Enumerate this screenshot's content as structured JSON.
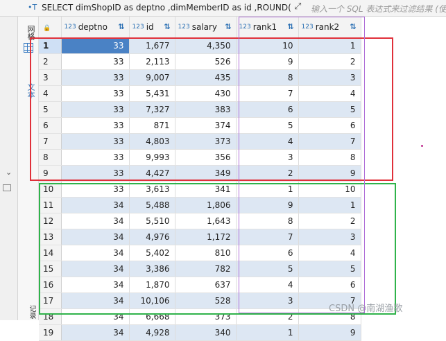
{
  "query": {
    "sql": "SELECT dimShopID as deptno ,dimMemberID as id ,ROUND(",
    "filter_placeholder": "输入一个 SQL 表达式来过滤结果 (使"
  },
  "sidebar": {
    "grid_tab": "网格",
    "text_tab": "文本",
    "record_tab": "记录"
  },
  "table": {
    "type_tag": "123",
    "columns": [
      "deptno",
      "id",
      "salary",
      "rank1",
      "rank2"
    ],
    "rows": [
      {
        "n": "1",
        "deptno": "33",
        "id": "1,677",
        "salary": "4,350",
        "rank1": "10",
        "rank2": "1"
      },
      {
        "n": "2",
        "deptno": "33",
        "id": "2,113",
        "salary": "526",
        "rank1": "9",
        "rank2": "2"
      },
      {
        "n": "3",
        "deptno": "33",
        "id": "9,007",
        "salary": "435",
        "rank1": "8",
        "rank2": "3"
      },
      {
        "n": "4",
        "deptno": "33",
        "id": "5,431",
        "salary": "430",
        "rank1": "7",
        "rank2": "4"
      },
      {
        "n": "5",
        "deptno": "33",
        "id": "7,327",
        "salary": "383",
        "rank1": "6",
        "rank2": "5"
      },
      {
        "n": "6",
        "deptno": "33",
        "id": "871",
        "salary": "374",
        "rank1": "5",
        "rank2": "6"
      },
      {
        "n": "7",
        "deptno": "33",
        "id": "4,803",
        "salary": "373",
        "rank1": "4",
        "rank2": "7"
      },
      {
        "n": "8",
        "deptno": "33",
        "id": "9,993",
        "salary": "356",
        "rank1": "3",
        "rank2": "8"
      },
      {
        "n": "9",
        "deptno": "33",
        "id": "4,427",
        "salary": "349",
        "rank1": "2",
        "rank2": "9"
      },
      {
        "n": "10",
        "deptno": "33",
        "id": "3,613",
        "salary": "341",
        "rank1": "1",
        "rank2": "10"
      },
      {
        "n": "11",
        "deptno": "34",
        "id": "5,488",
        "salary": "1,806",
        "rank1": "9",
        "rank2": "1"
      },
      {
        "n": "12",
        "deptno": "34",
        "id": "5,510",
        "salary": "1,643",
        "rank1": "8",
        "rank2": "2"
      },
      {
        "n": "13",
        "deptno": "34",
        "id": "4,976",
        "salary": "1,172",
        "rank1": "7",
        "rank2": "3"
      },
      {
        "n": "14",
        "deptno": "34",
        "id": "5,402",
        "salary": "810",
        "rank1": "6",
        "rank2": "4"
      },
      {
        "n": "15",
        "deptno": "34",
        "id": "3,386",
        "salary": "782",
        "rank1": "5",
        "rank2": "5"
      },
      {
        "n": "16",
        "deptno": "34",
        "id": "1,870",
        "salary": "637",
        "rank1": "4",
        "rank2": "6"
      },
      {
        "n": "17",
        "deptno": "34",
        "id": "10,106",
        "salary": "528",
        "rank1": "3",
        "rank2": "7"
      },
      {
        "n": "18",
        "deptno": "34",
        "id": "6,668",
        "salary": "373",
        "rank1": "2",
        "rank2": "8"
      },
      {
        "n": "19",
        "deptno": "34",
        "id": "4,928",
        "salary": "340",
        "rank1": "1",
        "rank2": "9"
      }
    ]
  },
  "watermark": "CSDN @南湖渔歌",
  "colors": {
    "accent": "#2a6fb3",
    "selected_cell": "#4a82c5",
    "red_box": "#e0303a",
    "green_box": "#2fb34a",
    "purple_box": "#b070d8"
  }
}
